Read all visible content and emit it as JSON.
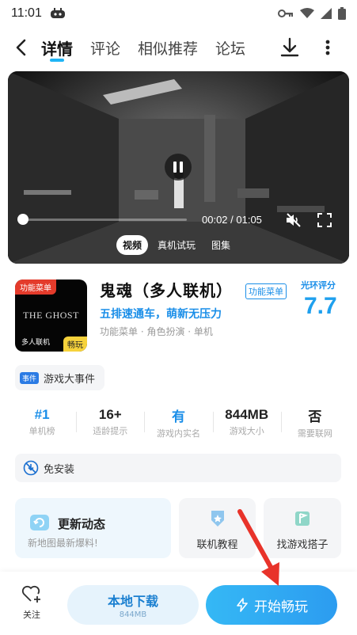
{
  "status_bar": {
    "time": "11:01"
  },
  "nav": {
    "tabs": [
      {
        "label": "详情",
        "active": true
      },
      {
        "label": "评论",
        "active": false
      },
      {
        "label": "相似推荐",
        "active": false
      },
      {
        "label": "论坛",
        "active": false
      }
    ]
  },
  "video": {
    "time_readout": "00:02 / 01:05",
    "progress_fraction": 0.03,
    "media_tabs": [
      {
        "label": "视频",
        "active": true
      },
      {
        "label": "真机试玩",
        "active": false
      },
      {
        "label": "图集",
        "active": false
      }
    ]
  },
  "game": {
    "icon_tag_top": "功能菜单",
    "icon_title": "THE GHOST",
    "icon_sub": "多人联机",
    "icon_tag_corner": "畅玩",
    "name": "鬼魂（多人联机）",
    "feature_badge": "功能菜单",
    "slogan": "五排速通车，萌新无压力",
    "tags": "功能菜单 · 角色扮演 · 单机",
    "rating_label": "光环评分",
    "rating_value": "7.7"
  },
  "event": {
    "badge": "事件",
    "label": "游戏大事件"
  },
  "stats": [
    {
      "value": "#1",
      "label": "单机榜",
      "highlight": true
    },
    {
      "value": "16+",
      "label": "适龄提示",
      "highlight": false
    },
    {
      "value": "有",
      "label": "游戏内实名",
      "highlight": true
    },
    {
      "value": "844MB",
      "label": "游戏大小",
      "highlight": false
    },
    {
      "value": "否",
      "label": "需要联网",
      "highlight": false
    }
  ],
  "no_install": {
    "label": "免安装"
  },
  "cards": {
    "update": {
      "title": "更新动态",
      "subtitle": "新地图最新爆料!"
    },
    "guide": {
      "label": "联机教程"
    },
    "partner": {
      "label": "找游戏搭子"
    }
  },
  "bottom": {
    "follow_label": "关注",
    "local_download_label": "本地下载",
    "local_download_size": "844MB",
    "play_label": "开始畅玩"
  },
  "colors": {
    "accent": "#1fa0ee",
    "play_button": "#2c9cf0",
    "red_arrow": "#e8332a"
  }
}
